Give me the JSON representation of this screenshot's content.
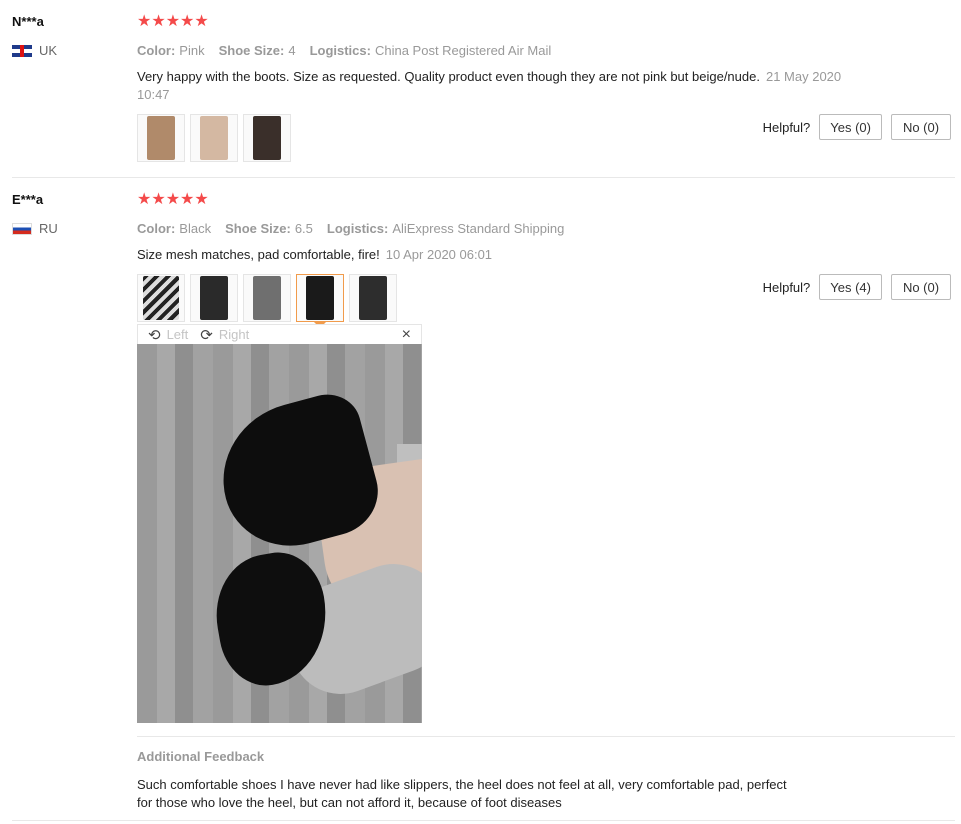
{
  "reviews": [
    {
      "user": "N***a",
      "country": "UK",
      "rating": 5,
      "stars": "★★★★★",
      "color_label": "Color:",
      "color": "Pink",
      "size_label": "Shoe Size:",
      "size": "4",
      "logistics_label": "Logistics:",
      "logistics": "China Post Registered Air Mail",
      "text": "Very happy with the boots. Size as requested. Quality product even though they are not pink but beige/nude.",
      "date": "21 May 2020 10:47",
      "helpful_label": "Helpful?",
      "yes": "Yes (0)",
      "no": "No (0)",
      "thumb_colors": [
        "#b08a6a",
        "#d4b8a2",
        "#3a2f2a"
      ]
    },
    {
      "user": "E***a",
      "country": "RU",
      "rating": 5,
      "stars": "★★★★★",
      "color_label": "Color:",
      "color": "Black",
      "size_label": "Shoe Size:",
      "size": "6.5",
      "logistics_label": "Logistics:",
      "logistics": "AliExpress Standard Shipping",
      "text": "Size mesh matches, pad comfortable, fire!",
      "date": "10 Apr 2020 06:01",
      "helpful_label": "Helpful?",
      "yes": "Yes (4)",
      "no": "No (0)",
      "thumb_colors": [
        "#4a4a4a",
        "#2a2a2a",
        "#6f6f6f",
        "#1a1a1a",
        "#2d2d2d"
      ],
      "viewer": {
        "left_label": "Left",
        "right_label": "Right",
        "close": "×"
      },
      "additional_title": "Additional Feedback",
      "additional_text": "Such comfortable shoes I have never had like slippers, the heel does not feel at all, very comfortable pad, perfect for those who love the heel, but can not afford it, because of foot diseases"
    }
  ],
  "colors": {
    "star": "#f44a4a",
    "muted": "#999999",
    "active_thumb": "#f19b4b"
  }
}
